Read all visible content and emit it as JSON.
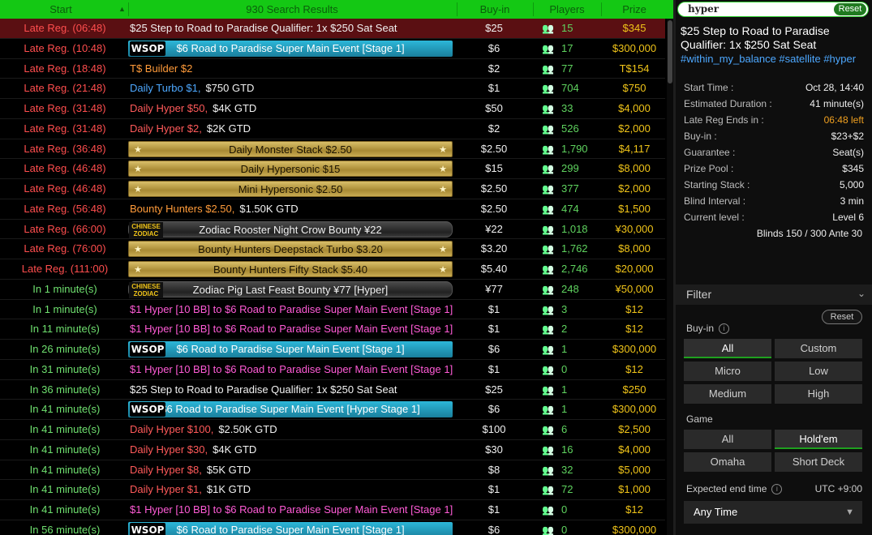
{
  "header": {
    "start": "Start",
    "search_results": "930 Search Results",
    "buyin": "Buy-in",
    "players": "Players",
    "prize": "Prize"
  },
  "rows": [
    {
      "start": "Late Reg. (06:48)",
      "status": "late",
      "name": "$25 Step to Road to Paradise Qualifier: 1x $250 Sat Seat",
      "name_color": "white",
      "style": "plain",
      "buyin": "$25",
      "players": "15",
      "prize": "$345",
      "selected": true
    },
    {
      "start": "Late Reg. (10:48)",
      "status": "late",
      "name": "$6 Road to Paradise Super Main Event [Stage 1]",
      "style": "wsop",
      "buyin": "$6",
      "players": "17",
      "prize": "$300,000"
    },
    {
      "start": "Late Reg. (18:48)",
      "status": "late",
      "name": "T$ Builder $2",
      "name_color": "orange",
      "style": "plain",
      "buyin": "$2",
      "players": "77",
      "prize": "T$154"
    },
    {
      "start": "Late Reg. (21:48)",
      "status": "late",
      "name": "Daily Turbo $1,",
      "name_color": "blue",
      "suffix": "$750 GTD",
      "style": "plain",
      "buyin": "$1",
      "players": "704",
      "prize": "$750"
    },
    {
      "start": "Late Reg. (31:48)",
      "status": "late",
      "name": "Daily Hyper $50,",
      "name_color": "red",
      "suffix": "$4K GTD",
      "style": "plain",
      "buyin": "$50",
      "players": "33",
      "prize": "$4,000"
    },
    {
      "start": "Late Reg. (31:48)",
      "status": "late",
      "name": "Daily Hyper $2,",
      "name_color": "red",
      "suffix": "$2K GTD",
      "style": "plain",
      "buyin": "$2",
      "players": "526",
      "prize": "$2,000"
    },
    {
      "start": "Late Reg. (36:48)",
      "status": "late",
      "name": "Daily Monster Stack $2.50",
      "style": "gold",
      "buyin": "$2.50",
      "players": "1,790",
      "prize": "$4,117"
    },
    {
      "start": "Late Reg. (46:48)",
      "status": "late",
      "name": "Daily Hypersonic $15",
      "style": "gold",
      "buyin": "$15",
      "players": "299",
      "prize": "$8,000"
    },
    {
      "start": "Late Reg. (46:48)",
      "status": "late",
      "name": "Mini Hypersonic $2.50",
      "style": "gold",
      "buyin": "$2.50",
      "players": "377",
      "prize": "$2,000"
    },
    {
      "start": "Late Reg. (56:48)",
      "status": "late",
      "name": "Bounty Hunters $2.50,",
      "name_color": "orange",
      "suffix": "$1.50K GTD",
      "style": "plain",
      "buyin": "$2.50",
      "players": "474",
      "prize": "$1,500"
    },
    {
      "start": "Late Reg. (66:00)",
      "status": "late",
      "name": "Zodiac Rooster Night Crow Bounty ¥22",
      "style": "zodiac",
      "buyin": "¥22",
      "players": "1,018",
      "prize": "¥30,000"
    },
    {
      "start": "Late Reg. (76:00)",
      "status": "late",
      "name": "Bounty Hunters Deepstack Turbo $3.20",
      "style": "gold",
      "buyin": "$3.20",
      "players": "1,762",
      "prize": "$8,000"
    },
    {
      "start": "Late Reg. (111:00)",
      "status": "late",
      "name": "Bounty Hunters Fifty Stack $5.40",
      "style": "gold",
      "buyin": "$5.40",
      "players": "2,746",
      "prize": "$20,000"
    },
    {
      "start": "In 1 minute(s)",
      "status": "in",
      "name": "Zodiac Pig Last Feast Bounty ¥77 [Hyper]",
      "style": "zodiac",
      "buyin": "¥77",
      "players": "248",
      "prize": "¥50,000"
    },
    {
      "start": "In 1 minute(s)",
      "status": "in",
      "name": "$1 Hyper [10 BB] to $6 Road to Paradise Super Main Event [Stage 1]",
      "name_color": "pink",
      "style": "plain",
      "buyin": "$1",
      "players": "3",
      "prize": "$12"
    },
    {
      "start": "In 11 minute(s)",
      "status": "in",
      "name": "$1 Hyper [10 BB] to $6 Road to Paradise Super Main Event [Stage 1]",
      "name_color": "pink",
      "style": "plain",
      "buyin": "$1",
      "players": "2",
      "prize": "$12"
    },
    {
      "start": "In 26 minute(s)",
      "status": "in",
      "name": "$6 Road to Paradise Super Main Event [Stage 1]",
      "style": "wsop",
      "buyin": "$6",
      "players": "1",
      "prize": "$300,000"
    },
    {
      "start": "In 31 minute(s)",
      "status": "in",
      "name": "$1 Hyper [10 BB] to $6 Road to Paradise Super Main Event [Stage 1]",
      "name_color": "pink",
      "style": "plain",
      "buyin": "$1",
      "players": "0",
      "prize": "$12"
    },
    {
      "start": "In 36 minute(s)",
      "status": "in",
      "name": "$25 Step to Road to Paradise Qualifier: 1x $250 Sat Seat",
      "name_color": "white",
      "style": "plain",
      "buyin": "$25",
      "players": "1",
      "prize": "$250"
    },
    {
      "start": "In 41 minute(s)",
      "status": "in",
      "name": "$6 Road to Paradise Super Main Event [Hyper Stage 1]",
      "style": "wsop",
      "buyin": "$6",
      "players": "1",
      "prize": "$300,000"
    },
    {
      "start": "In 41 minute(s)",
      "status": "in",
      "name": "Daily Hyper $100,",
      "name_color": "red",
      "suffix": "$2.50K GTD",
      "style": "plain",
      "buyin": "$100",
      "players": "6",
      "prize": "$2,500"
    },
    {
      "start": "In 41 minute(s)",
      "status": "in",
      "name": "Daily Hyper $30,",
      "name_color": "red",
      "suffix": "$4K GTD",
      "style": "plain",
      "buyin": "$30",
      "players": "16",
      "prize": "$4,000"
    },
    {
      "start": "In 41 minute(s)",
      "status": "in",
      "name": "Daily Hyper $8,",
      "name_color": "red",
      "suffix": "$5K GTD",
      "style": "plain",
      "buyin": "$8",
      "players": "32",
      "prize": "$5,000"
    },
    {
      "start": "In 41 minute(s)",
      "status": "in",
      "name": "Daily Hyper $1,",
      "name_color": "red",
      "suffix": "$1K GTD",
      "style": "plain",
      "buyin": "$1",
      "players": "72",
      "prize": "$1,000"
    },
    {
      "start": "In 41 minute(s)",
      "status": "in",
      "name": "$1 Hyper [10 BB] to $6 Road to Paradise Super Main Event [Stage 1]",
      "name_color": "pink",
      "style": "plain",
      "buyin": "$1",
      "players": "0",
      "prize": "$12"
    },
    {
      "start": "In 56 minute(s)",
      "status": "in",
      "name": "$6 Road to Paradise Super Main Event [Stage 1]",
      "style": "wsop",
      "buyin": "$6",
      "players": "0",
      "prize": "$300,000"
    }
  ],
  "badges": {
    "wsop": "WSOP",
    "zodiac_line1": "CHINESE",
    "zodiac_line2": "ZODIAC"
  },
  "search": {
    "value": "hyper",
    "reset_label": "Reset"
  },
  "selected": {
    "title": "$25 Step to Road to Paradise Qualifier: 1x $250 Sat Seat",
    "tags": "#within_my_balance #satellite #hyper",
    "details": [
      {
        "label": "Start Time :",
        "value": "Oct 28, 14:40"
      },
      {
        "label": "Estimated Duration :",
        "value": "41 minute(s)"
      },
      {
        "label": "Late Reg Ends in :",
        "value": "06:48 left",
        "highlight": true
      },
      {
        "label": "Buy-in :",
        "value": "$23+$2"
      },
      {
        "label": "Guarantee :",
        "value": "Seat(s)"
      },
      {
        "label": "Prize Pool :",
        "value": "$345"
      },
      {
        "label": "Starting Stack :",
        "value": "5,000"
      },
      {
        "label": "Blind Interval :",
        "value": "3 min"
      },
      {
        "label": "Current level :",
        "value": "Level 6"
      }
    ],
    "blinds": "Blinds 150 / 300 Ante 30"
  },
  "filter": {
    "title": "Filter",
    "reset_label": "Reset",
    "buyin_label": "Buy-in",
    "buyin_options": [
      "All",
      "Custom",
      "Micro",
      "Low",
      "Medium",
      "High"
    ],
    "buyin_selected": "All",
    "game_label": "Game",
    "game_options": [
      "All",
      "Hold'em",
      "Omaha",
      "Short Deck"
    ],
    "game_selected": "Hold'em",
    "end_time_label": "Expected end time",
    "timezone": "UTC +9:00",
    "end_time_value": "Any Time"
  },
  "colors": {
    "header_green": "#14c814",
    "late_red": "#ff4e4e",
    "in_green": "#6fe06f",
    "prize_gold": "#f0c419",
    "selected_row": "#5a0f12",
    "tag_blue": "#4da8ff"
  },
  "icons": {
    "players": "players-icon",
    "sort": "sort-up-icon",
    "help": "help-icon",
    "chevron": "chevron-down-icon",
    "star": "star-icon"
  }
}
